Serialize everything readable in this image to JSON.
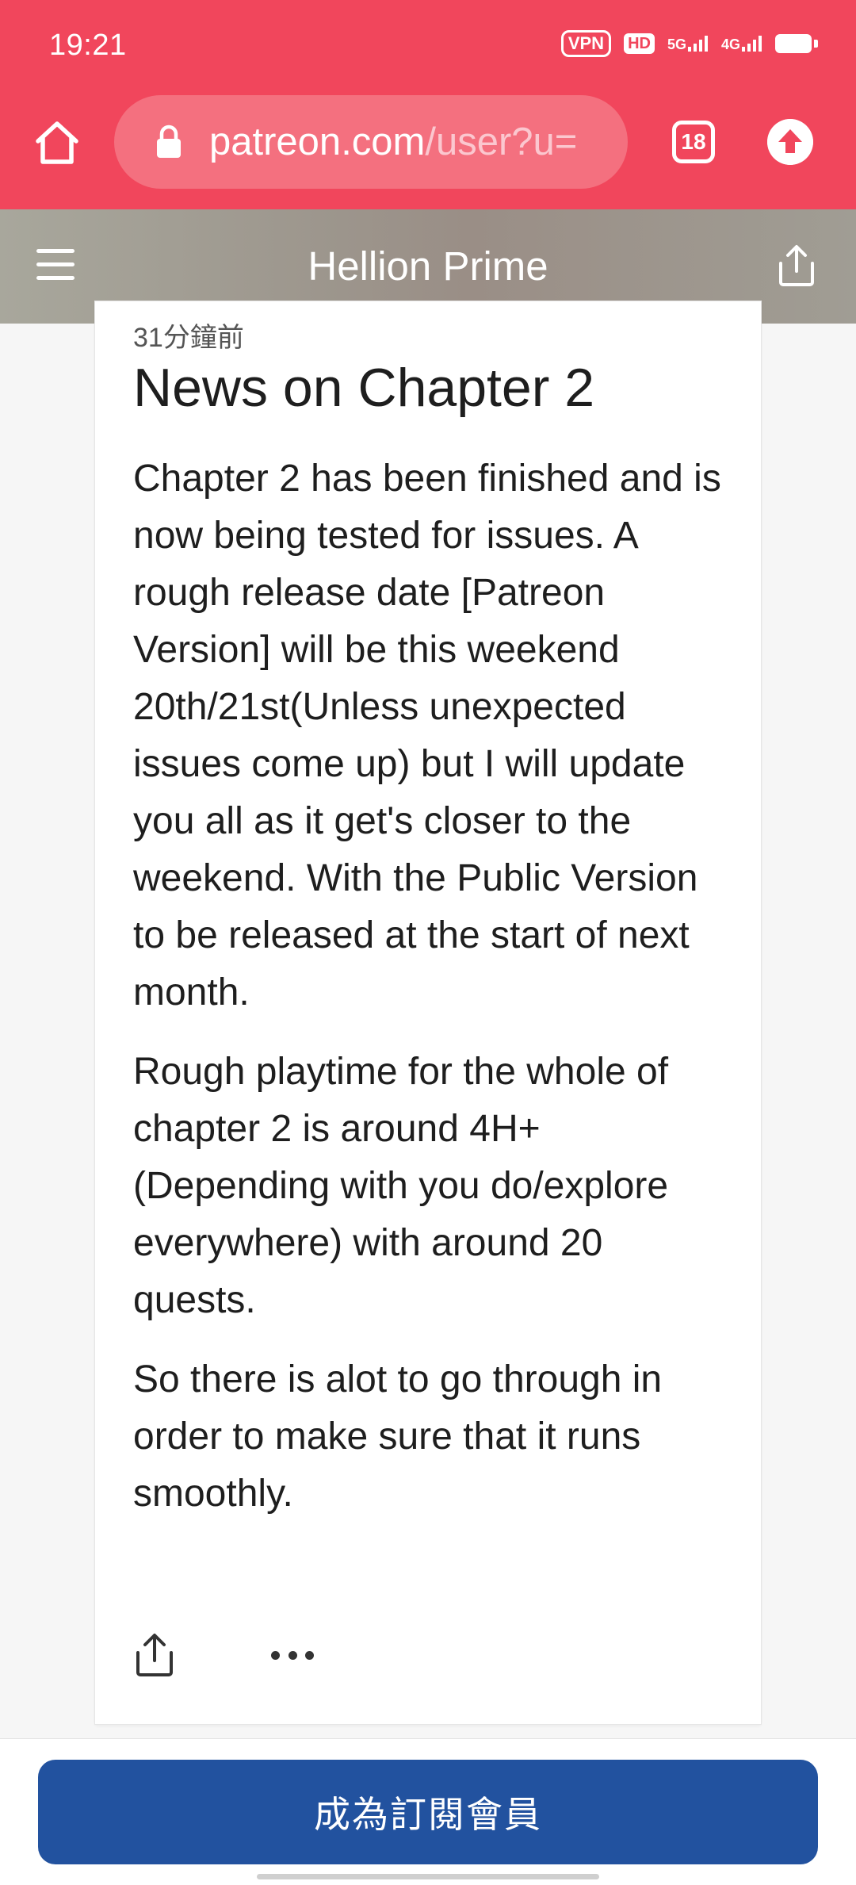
{
  "status_bar": {
    "time": "19:21",
    "vpn": "VPN",
    "hd": "HD",
    "net1": "5G",
    "net2": "4G"
  },
  "browser": {
    "url_domain": "patreon.com",
    "url_path": "/user?u=",
    "tab_count": "18"
  },
  "site": {
    "title": "Hellion Prime"
  },
  "post": {
    "time": "31分鐘前",
    "title": "News on Chapter 2",
    "paragraphs": [
      "Chapter 2 has been finished and is now being tested for issues. A rough release date [Patreon Version] will be this weekend 20th/21st(Unless unexpected issues come up) but I will update you all as it get's closer to the weekend. With the Public Version to be released at the start of next month.",
      "Rough playtime for the whole of chapter 2 is around 4H+ (Depending with you do/explore everywhere) with around 20 quests.",
      "So there is alot to go through in order to make sure that it runs smoothly."
    ]
  },
  "bottom": {
    "join_label": "成為訂閱會員"
  },
  "colors": {
    "browser_bar": "#f1465c",
    "url_pill": "#f4707f",
    "join_button": "#22529f"
  },
  "icons": [
    "home-icon",
    "lock-icon",
    "tabs-icon",
    "upgrade-arrow-icon",
    "menu-icon",
    "share-icon",
    "more-icon"
  ]
}
